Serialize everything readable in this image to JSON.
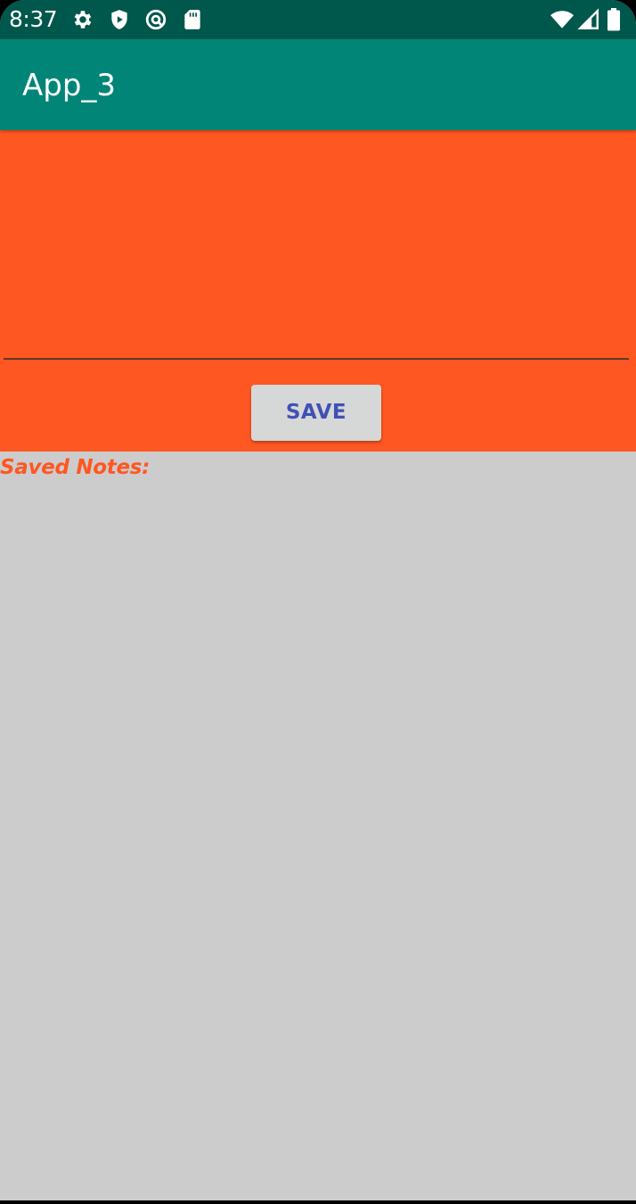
{
  "status_bar": {
    "time": "8:37",
    "left_icons": [
      "gear-icon",
      "shield-play-icon",
      "at-sign-icon",
      "sd-card-icon"
    ],
    "right_icons": [
      "wifi-icon",
      "cell-signal-icon",
      "battery-icon"
    ],
    "background": "#00574b"
  },
  "app_bar": {
    "title": "App_3",
    "background": "#008577"
  },
  "editor": {
    "input_value": "",
    "input_placeholder": "",
    "save_label": "SAVE",
    "background": "#ff5722",
    "button_text_color": "#3f51b5"
  },
  "saved_notes": {
    "label": "Saved Notes:",
    "items": [],
    "label_color": "#ff5722",
    "background": "#cccccc"
  }
}
